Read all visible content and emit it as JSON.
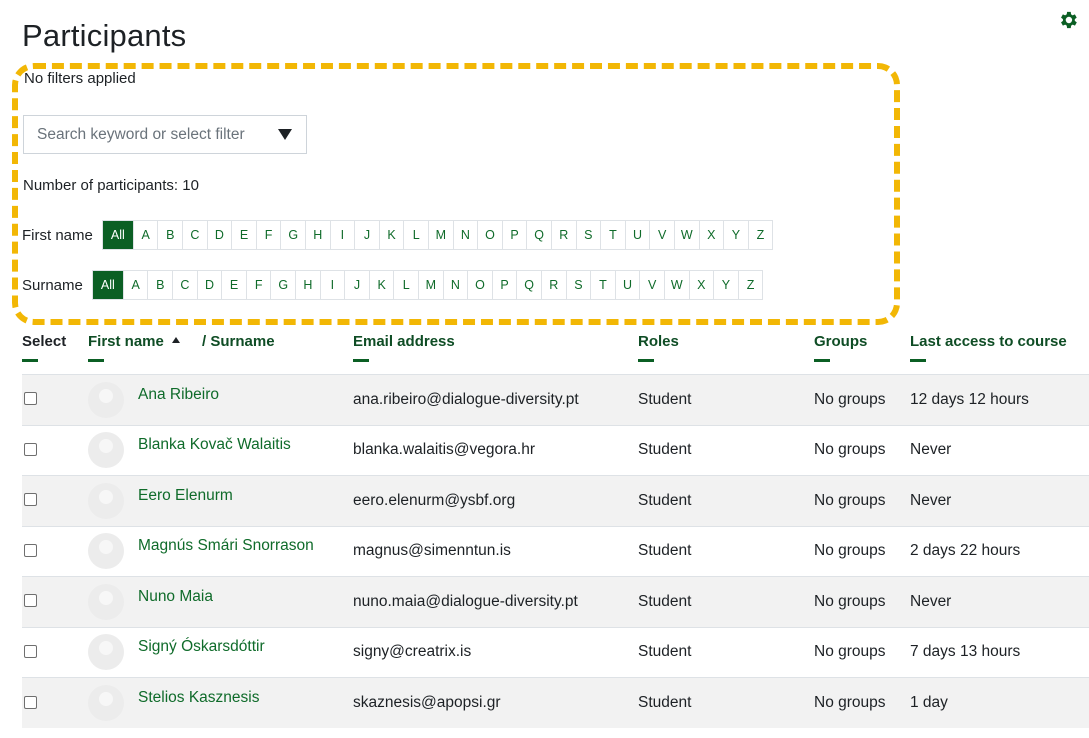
{
  "page": {
    "title": "Participants"
  },
  "filters": {
    "status": "No filters applied",
    "search_placeholder": "Search keyword or select filter",
    "participant_count": "Number of participants: 10"
  },
  "initials": {
    "first_name_label": "First name",
    "surname_label": "Surname",
    "letters": [
      "All",
      "A",
      "B",
      "C",
      "D",
      "E",
      "F",
      "G",
      "H",
      "I",
      "J",
      "K",
      "L",
      "M",
      "N",
      "O",
      "P",
      "Q",
      "R",
      "S",
      "T",
      "U",
      "V",
      "W",
      "X",
      "Y",
      "Z"
    ]
  },
  "table": {
    "headers": {
      "select": "Select",
      "first_name": "First name",
      "surname": "/ Surname",
      "email": "Email address",
      "roles": "Roles",
      "groups": "Groups",
      "last_access": "Last access to course"
    },
    "rows": [
      {
        "name": "Ana Ribeiro",
        "email": "ana.ribeiro@dialogue-diversity.pt",
        "role": "Student",
        "groups": "No groups",
        "last_access": "12 days 12 hours"
      },
      {
        "name": "Blanka Kovač Walaitis",
        "email": "blanka.walaitis@vegora.hr",
        "role": "Student",
        "groups": "No groups",
        "last_access": "Never"
      },
      {
        "name": "Eero Elenurm",
        "email": "eero.elenurm@ysbf.org",
        "role": "Student",
        "groups": "No groups",
        "last_access": "Never"
      },
      {
        "name": "Magnús Smári Snorrason",
        "email": "magnus@simenntun.is",
        "role": "Student",
        "groups": "No groups",
        "last_access": "2 days 22 hours"
      },
      {
        "name": "Nuno Maia",
        "email": "nuno.maia@dialogue-diversity.pt",
        "role": "Student",
        "groups": "No groups",
        "last_access": "Never"
      },
      {
        "name": "Signý Óskarsdóttir",
        "email": "signy@creatrix.is",
        "role": "Student",
        "groups": "No groups",
        "last_access": "7 days 13 hours"
      },
      {
        "name": "Stelios Kasznesis",
        "email": "skaznesis@apopsi.gr",
        "role": "Student",
        "groups": "No groups",
        "last_access": "1 day"
      }
    ]
  },
  "colors": {
    "accent": "#0b5f24",
    "link": "#0f6b2a",
    "highlight": "#f2b705"
  },
  "icons": {
    "settings": "gear-icon",
    "filter_dropdown": "caret-down-icon",
    "sort": "sort-ascending-icon"
  }
}
